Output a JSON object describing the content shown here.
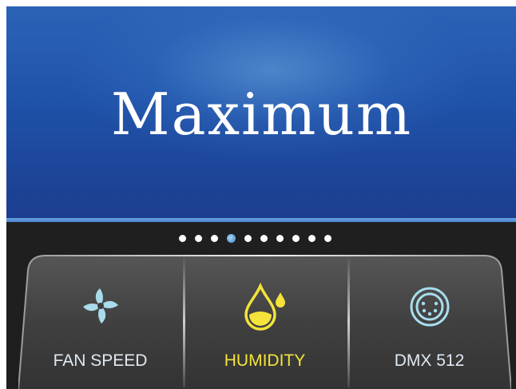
{
  "display": {
    "mode_text": "Maximum"
  },
  "pager": {
    "count": 10,
    "active_index": 3
  },
  "controls": [
    {
      "label": "FAN SPEED",
      "icon": "fan-icon",
      "color": "#dfe9f3"
    },
    {
      "label": "HUMIDITY",
      "icon": "water-drops-icon",
      "color": "#f3e33a"
    },
    {
      "label": "DMX 512",
      "icon": "dmx-connector-icon",
      "color": "#dfe9f3"
    }
  ],
  "colors": {
    "accent_blue": "#2b63b7",
    "active_yellow": "#f3e33a",
    "icon_light_blue": "#a8dcec"
  }
}
